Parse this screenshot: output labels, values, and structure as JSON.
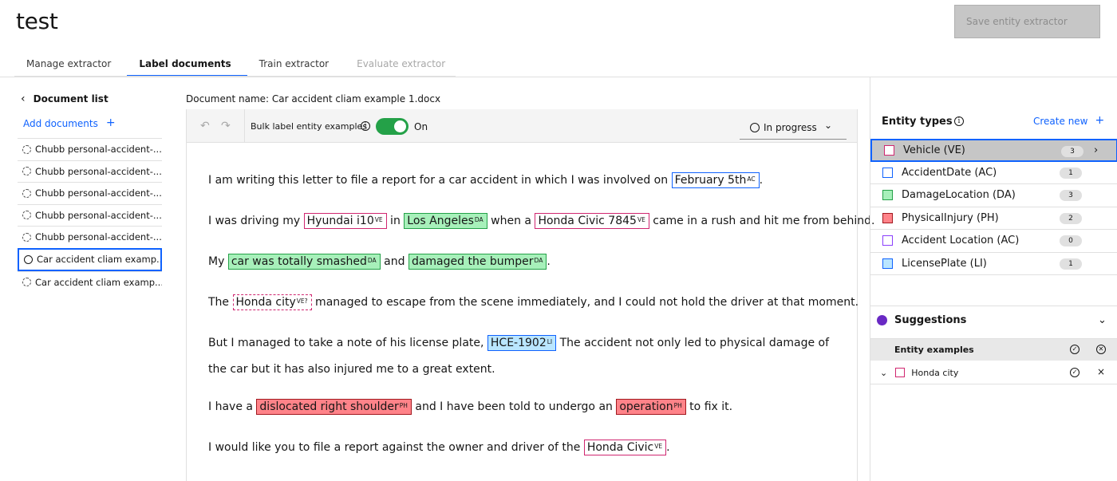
{
  "app_title": "test",
  "save_button": "Save entity extractor",
  "tabs": [
    {
      "label": "Manage extractor"
    },
    {
      "label": "Label documents"
    },
    {
      "label": "Train extractor"
    },
    {
      "label": "Evaluate extractor"
    }
  ],
  "sidebar": {
    "back_icon": "chevron-left-icon",
    "title": "Document list",
    "add_label": "Add documents",
    "add_icon": "plus-icon",
    "documents": [
      {
        "name": "Chubb personal-accident-...",
        "status": "not-started"
      },
      {
        "name": "Chubb personal-accident-...",
        "status": "not-started"
      },
      {
        "name": "Chubb personal-accident-...",
        "status": "not-started"
      },
      {
        "name": "Chubb personal-accident-...",
        "status": "not-started"
      },
      {
        "name": "Chubb personal-accident-...",
        "status": "not-started"
      },
      {
        "name": "Car accident cliam examp...",
        "status": "in-progress",
        "selected": true
      },
      {
        "name": "Car accident cliam examp...",
        "status": "not-started"
      }
    ]
  },
  "document": {
    "name_label": "Document name: Car accident cliam example 1.docx",
    "toolbar": {
      "undo_icon": "undo-icon",
      "redo_icon": "redo-icon",
      "bulk_label": "Bulk label entity examples",
      "toggle_state": "On",
      "status": "In progress"
    },
    "paragraphs": [
      [
        {
          "t": "I am writing this letter to file a report for a car accident in which I was involved on "
        },
        {
          "t": "February 5th",
          "tag": "AC",
          "cls": "ac"
        },
        {
          "t": "."
        }
      ],
      [
        {
          "t": "I was driving my "
        },
        {
          "t": "Hyundai i10",
          "tag": "VE",
          "cls": "ve"
        },
        {
          "t": " in "
        },
        {
          "t": "Los Angeles",
          "tag": "DA",
          "cls": "da"
        },
        {
          "t": " when a "
        },
        {
          "t": "Honda Civic 7845",
          "tag": "VE",
          "cls": "ve"
        },
        {
          "t": " came in a rush and hit me from behind."
        }
      ],
      [
        {
          "t": "My "
        },
        {
          "t": "car was totally smashed",
          "tag": "DA",
          "cls": "da"
        },
        {
          "t": " and "
        },
        {
          "t": "damaged the bumper",
          "tag": "DA",
          "cls": "da"
        },
        {
          "t": "."
        }
      ],
      [
        {
          "t": "The "
        },
        {
          "t": "Honda city",
          "tag": "VE?",
          "cls": "ve-dash"
        },
        {
          "t": " managed to escape from the scene immediately, and I could not hold the driver at that moment."
        }
      ],
      [
        {
          "t": "But I managed to take a note of his license plate, "
        },
        {
          "t": "HCE-1902",
          "tag": "LI",
          "cls": "li"
        },
        {
          "t": " The accident not only led to physical damage of the car but it has also injured me to a great extent."
        }
      ],
      [
        {
          "t": "I have a "
        },
        {
          "t": "dislocated right shoulder",
          "tag": "PH",
          "cls": "ph"
        },
        {
          "t": " and I have been told to undergo an "
        },
        {
          "t": "operation",
          "tag": "PH",
          "cls": "ph"
        },
        {
          "t": " to fix it."
        }
      ],
      [
        {
          "t": "I would like you to file a report against the owner and driver of the "
        },
        {
          "t": "Honda Civic",
          "tag": "VE",
          "cls": "ve"
        },
        {
          "t": "."
        }
      ]
    ]
  },
  "entity_panel": {
    "title": "Entity types",
    "create_label": "Create new",
    "entities": [
      {
        "label": "Vehicle (VE)",
        "count": "3",
        "color": "#d02670",
        "fill": "#ffffff",
        "selected": true
      },
      {
        "label": "AccidentDate (AC)",
        "count": "1",
        "color": "#0f62fe",
        "fill": "#ffffff"
      },
      {
        "label": "DamageLocation (DA)",
        "count": "3",
        "color": "#24a148",
        "fill": "#a7f0ba"
      },
      {
        "label": "PhysicalInjury (PH)",
        "count": "2",
        "color": "#a2191f",
        "fill": "#ff8389"
      },
      {
        "label": "Accident Location (AC)",
        "count": "0",
        "color": "#8a3ffc",
        "fill": "#ffffff"
      },
      {
        "label": "LicensePlate (LI)",
        "count": "1",
        "color": "#0f62fe",
        "fill": "#bae6ff"
      }
    ],
    "suggestions": {
      "title": "Suggestions",
      "dot_color": "#6929c4",
      "table_header": "Entity examples",
      "rows": [
        {
          "label": "Honda city",
          "color": "#d02670"
        }
      ]
    }
  }
}
